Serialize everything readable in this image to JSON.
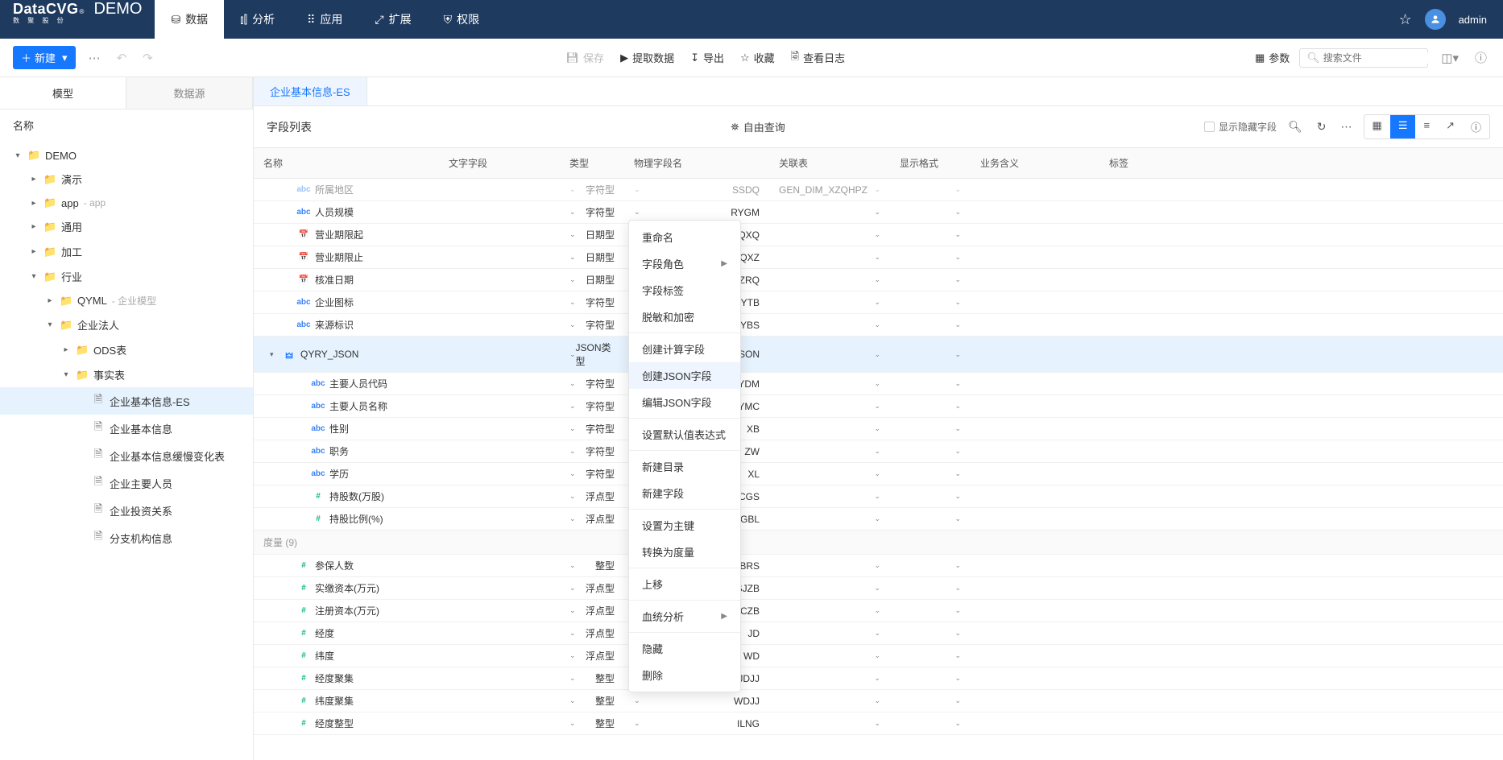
{
  "brand": {
    "name": "DataCVG",
    "sup": "®",
    "sub": "数 聚 股 份",
    "demo": "DEMO"
  },
  "nav": {
    "items": [
      {
        "icon": "database",
        "label": "数据"
      },
      {
        "icon": "chart",
        "label": "分析"
      },
      {
        "icon": "apps",
        "label": "应用"
      },
      {
        "icon": "extend",
        "label": "扩展"
      },
      {
        "icon": "shield",
        "label": "权限"
      }
    ],
    "user": "admin"
  },
  "toolbar": {
    "new_label": "新建",
    "center": [
      {
        "icon": "save",
        "label": "保存",
        "disabled": true
      },
      {
        "icon": "play",
        "label": "提取数据"
      },
      {
        "icon": "export",
        "label": "导出"
      },
      {
        "icon": "star",
        "label": "收藏"
      },
      {
        "icon": "log",
        "label": "查看日志"
      }
    ],
    "params_label": "参数",
    "search_placeholder": "搜索文件"
  },
  "sidebar": {
    "tabs": [
      "模型",
      "数据源"
    ],
    "header": "名称",
    "tree": [
      {
        "depth": 0,
        "chev": "▾",
        "type": "folder",
        "label": "DEMO"
      },
      {
        "depth": 1,
        "chev": "▸",
        "type": "folder",
        "label": "演示"
      },
      {
        "depth": 1,
        "chev": "▸",
        "type": "folder",
        "label": "app",
        "sec": " - app"
      },
      {
        "depth": 1,
        "chev": "▸",
        "type": "folder",
        "label": "通用"
      },
      {
        "depth": 1,
        "chev": "▸",
        "type": "folder",
        "label": "加工"
      },
      {
        "depth": 1,
        "chev": "▾",
        "type": "folder",
        "label": "行业"
      },
      {
        "depth": 2,
        "chev": "▸",
        "type": "folder",
        "label": "QYML",
        "sec": " - 企业模型"
      },
      {
        "depth": 2,
        "chev": "▾",
        "type": "folder",
        "label": "企业法人"
      },
      {
        "depth": 3,
        "chev": "▸",
        "type": "folder",
        "label": "ODS表"
      },
      {
        "depth": 3,
        "chev": "▾",
        "type": "folder",
        "label": "事实表"
      },
      {
        "depth": 4,
        "chev": "",
        "type": "file",
        "label": "企业基本信息-ES",
        "selected": true
      },
      {
        "depth": 4,
        "chev": "",
        "type": "file",
        "label": "企业基本信息"
      },
      {
        "depth": 4,
        "chev": "",
        "type": "file",
        "label": "企业基本信息缓慢变化表"
      },
      {
        "depth": 4,
        "chev": "",
        "type": "file",
        "label": "企业主要人员"
      },
      {
        "depth": 4,
        "chev": "",
        "type": "file",
        "label": "企业投资关系"
      },
      {
        "depth": 4,
        "chev": "",
        "type": "file",
        "label": "分支机构信息"
      }
    ]
  },
  "content": {
    "tab": "企业基本信息-ES",
    "title": "字段列表",
    "free_query": "自由查询",
    "show_hidden": "显示隐藏字段",
    "columns": [
      "名称",
      "文字字段",
      "类型",
      "物理字段名",
      "关联表",
      "显示格式",
      "业务含义",
      "标签"
    ],
    "rows": [
      {
        "indent": 1,
        "icon": "abc",
        "name": "所属地区",
        "type": "字符型",
        "phys": "SSDQ",
        "assoc": "GEN_DIM_XZQHPZ",
        "cut": true
      },
      {
        "indent": 1,
        "icon": "abc",
        "name": "人员规模",
        "type": "字符型",
        "phys": "RYGM"
      },
      {
        "indent": 1,
        "icon": "date",
        "name": "营业期限起",
        "type": "日期型",
        "phys": "YYQXQ"
      },
      {
        "indent": 1,
        "icon": "date",
        "name": "营业期限止",
        "type": "日期型",
        "phys": "YYQXZ"
      },
      {
        "indent": 1,
        "icon": "date",
        "name": "核准日期",
        "type": "日期型",
        "phys": "HZRQ"
      },
      {
        "indent": 1,
        "icon": "abc",
        "name": "企业图标",
        "type": "字符型",
        "phys": "QYTB"
      },
      {
        "indent": 1,
        "icon": "abc",
        "name": "来源标识",
        "type": "字符型",
        "phys": "LYBS"
      },
      {
        "indent": 0,
        "chev": "▾",
        "icon": "json",
        "name": "QYRY_JSON",
        "type": "JSON类型",
        "phys": "QYRY_JSON",
        "selected": true
      },
      {
        "indent": 2,
        "icon": "abc",
        "name": "主要人员代码",
        "type": "字符型",
        "phys": "ZYRYDM"
      },
      {
        "indent": 2,
        "icon": "abc",
        "name": "主要人员名称",
        "type": "字符型",
        "phys": "ZYRYMC"
      },
      {
        "indent": 2,
        "icon": "abc",
        "name": "性别",
        "type": "字符型",
        "phys": "XB"
      },
      {
        "indent": 2,
        "icon": "abc",
        "name": "职务",
        "type": "字符型",
        "phys": "ZW"
      },
      {
        "indent": 2,
        "icon": "abc",
        "name": "学历",
        "type": "字符型",
        "phys": "XL"
      },
      {
        "indent": 2,
        "icon": "num",
        "name": "持股数(万股)",
        "type": "浮点型",
        "phys": "CGS"
      },
      {
        "indent": 2,
        "icon": "num",
        "name": "持股比例(%)",
        "type": "浮点型",
        "phys": "CGBL"
      },
      {
        "section": "度量 (9)"
      },
      {
        "indent": 1,
        "icon": "num",
        "name": "参保人数",
        "type": "整型",
        "phys": "CBRS"
      },
      {
        "indent": 1,
        "icon": "num",
        "name": "实缴资本(万元)",
        "type": "浮点型",
        "phys": "SJZB"
      },
      {
        "indent": 1,
        "icon": "num",
        "name": "注册资本(万元)",
        "type": "浮点型",
        "phys": "ZCZB"
      },
      {
        "indent": 1,
        "icon": "num",
        "name": "经度",
        "type": "浮点型",
        "phys": "JD"
      },
      {
        "indent": 1,
        "icon": "num",
        "name": "纬度",
        "type": "浮点型",
        "phys": "WD"
      },
      {
        "indent": 1,
        "icon": "num",
        "name": "经度聚集",
        "type": "整型",
        "phys": "JDJJ"
      },
      {
        "indent": 1,
        "icon": "num",
        "name": "纬度聚集",
        "type": "整型",
        "phys": "WDJJ"
      },
      {
        "indent": 1,
        "icon": "num",
        "name": "经度整型",
        "type": "整型",
        "phys": "ILNG"
      }
    ]
  },
  "context_menu": {
    "groups": [
      [
        {
          "label": "重命名"
        },
        {
          "label": "字段角色",
          "sub": true
        },
        {
          "label": "字段标签"
        },
        {
          "label": "脱敏和加密"
        }
      ],
      [
        {
          "label": "创建计算字段"
        },
        {
          "label": "创建JSON字段",
          "hl": true
        },
        {
          "label": "编辑JSON字段"
        }
      ],
      [
        {
          "label": "设置默认值表达式"
        }
      ],
      [
        {
          "label": "新建目录"
        },
        {
          "label": "新建字段"
        }
      ],
      [
        {
          "label": "设置为主键"
        },
        {
          "label": "转换为度量"
        }
      ],
      [
        {
          "label": "上移"
        }
      ],
      [
        {
          "label": "血统分析",
          "sub": true
        }
      ],
      [
        {
          "label": "隐藏"
        },
        {
          "label": "删除"
        }
      ]
    ]
  }
}
